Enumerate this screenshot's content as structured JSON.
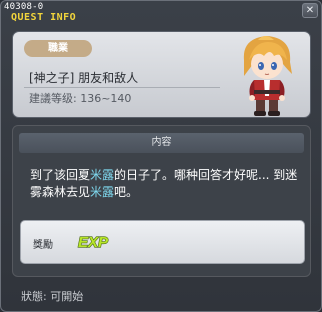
{
  "window": {
    "quest_id": "40308-0",
    "title": "QUEST INFO",
    "close_glyph": "✕"
  },
  "job": {
    "badge": "職業",
    "quest_name": "[神之子] 朋友和敌人",
    "level": "建議等级: 136~140"
  },
  "content": {
    "header": "内容",
    "desc_parts": [
      "到了该回夏",
      "米露",
      "的日子了。哪种回答才好呢... 到迷雾森林去见",
      "米露",
      "吧。"
    ]
  },
  "reward": {
    "label": "獎勵",
    "icon": "exp-icon",
    "icon_text": "EXP"
  },
  "status": "狀態:  可開始",
  "colors": {
    "title": "#f2d53c",
    "highlight": "#7fd9ef",
    "exp": "#b8e62a"
  }
}
